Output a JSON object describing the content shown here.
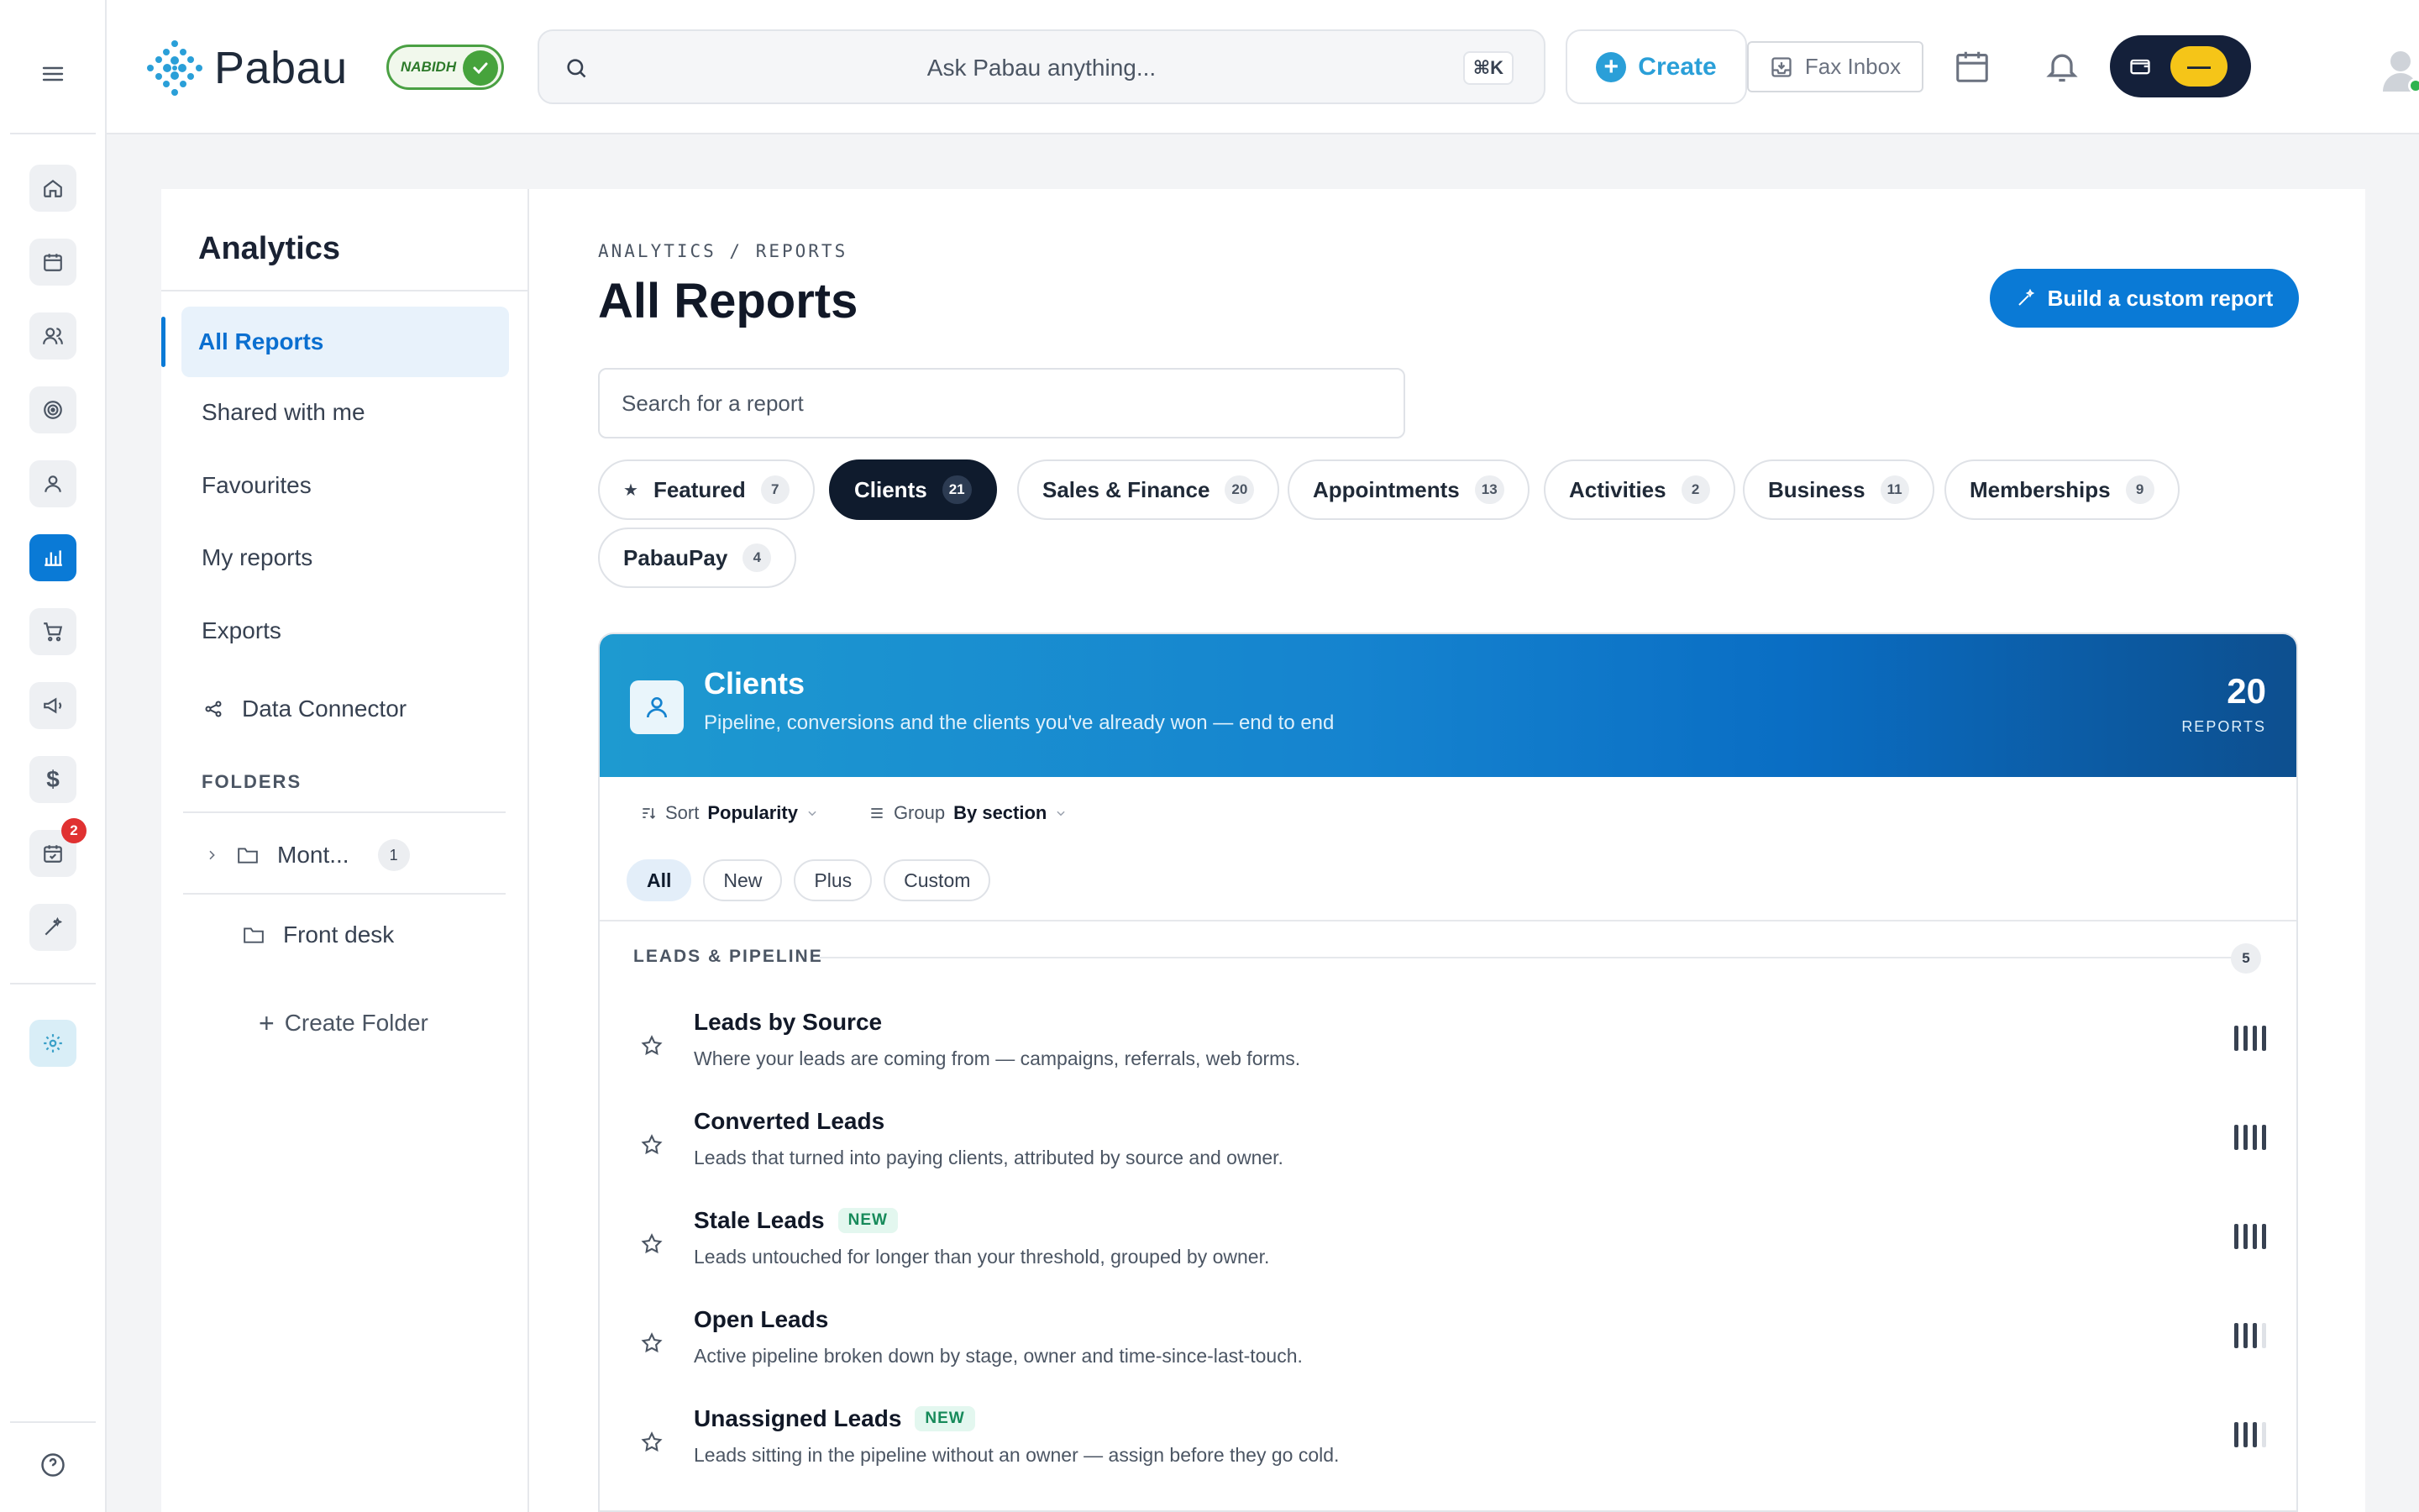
{
  "app": {
    "brand": "Pabau",
    "badge_text": "NABIDH"
  },
  "colors": {
    "accent": "#0a7ad6",
    "brand": "#2a9fd8",
    "dark": "#0f1b2d",
    "new_badge": "#168a5a",
    "notification": "#e03131"
  },
  "rail": {
    "items": [
      {
        "name": "menu",
        "icon": "hamburger-icon"
      },
      {
        "name": "home",
        "icon": "home-icon"
      },
      {
        "name": "calendar",
        "icon": "calendar-icon"
      },
      {
        "name": "contacts",
        "icon": "users-icon"
      },
      {
        "name": "leads",
        "icon": "target-icon"
      },
      {
        "name": "clients",
        "icon": "user-icon"
      },
      {
        "name": "analytics",
        "icon": "bar-chart-icon",
        "active": true
      },
      {
        "name": "shop",
        "icon": "cart-icon"
      },
      {
        "name": "marketing",
        "icon": "megaphone-icon"
      },
      {
        "name": "finance",
        "icon": "dollar-icon"
      },
      {
        "name": "tasks",
        "icon": "calendar-check-icon",
        "badge": "2"
      },
      {
        "name": "tools",
        "icon": "magic-wand-icon"
      },
      {
        "name": "settings",
        "icon": "gear-icon"
      },
      {
        "name": "help",
        "icon": "help-icon"
      }
    ]
  },
  "topbar": {
    "search_placeholder": "Ask Pabau anything...",
    "shortcut": "⌘K",
    "create_label": "Create",
    "fax_label": "Fax Inbox",
    "wallet_pill": "—"
  },
  "sidebar": {
    "title": "Analytics",
    "items": [
      {
        "label": "All Reports",
        "active": true
      },
      {
        "label": "Shared with me"
      },
      {
        "label": "Favourites"
      },
      {
        "label": "My reports"
      },
      {
        "label": "Exports"
      }
    ],
    "data_connector": "Data Connector",
    "folders_heading": "FOLDERS",
    "folders": [
      {
        "label": "Mont...",
        "count": "1",
        "expandable": true
      },
      {
        "label": "Front desk"
      }
    ],
    "create_folder": "Create Folder"
  },
  "main": {
    "breadcrumb": "ANALYTICS / REPORTS",
    "title": "All Reports",
    "build_button": "Build a custom report",
    "search_placeholder": "Search for a report",
    "categories": [
      {
        "label": "Featured",
        "count": "7",
        "star": true
      },
      {
        "label": "Clients",
        "count": "21",
        "active": true
      },
      {
        "label": "Sales & Finance",
        "count": "20"
      },
      {
        "label": "Appointments",
        "count": "13"
      },
      {
        "label": "Activities",
        "count": "2"
      },
      {
        "label": "Business",
        "count": "11"
      },
      {
        "label": "Memberships",
        "count": "9"
      },
      {
        "label": "PabauPay",
        "count": "4"
      }
    ]
  },
  "card": {
    "title": "Clients",
    "subtitle": "Pipeline, conversions and the clients you've already won — end to end",
    "count": "20",
    "count_label": "REPORTS",
    "sort_label": "Sort",
    "sort_value": "Popularity",
    "group_label": "Group",
    "group_value": "By section",
    "filters": [
      {
        "label": "All",
        "active": true
      },
      {
        "label": "New"
      },
      {
        "label": "Plus"
      },
      {
        "label": "Custom"
      }
    ],
    "section": {
      "title": "LEADS & PIPELINE",
      "count": "5"
    },
    "reports": [
      {
        "title": "Leads by Source",
        "desc": "Where your leads are coming from — campaigns, referrals, web forms.",
        "new": false,
        "popularity": 4
      },
      {
        "title": "Converted Leads",
        "desc": "Leads that turned into paying clients, attributed by source and owner.",
        "new": false,
        "popularity": 4
      },
      {
        "title": "Stale Leads",
        "desc": "Leads untouched for longer than your threshold, grouped by owner.",
        "new": true,
        "badge": "NEW",
        "popularity": 4
      },
      {
        "title": "Open Leads",
        "desc": "Active pipeline broken down by stage, owner and time-since-last-touch.",
        "new": false,
        "popularity": 3
      },
      {
        "title": "Unassigned Leads",
        "desc": "Leads sitting in the pipeline without an owner — assign before they go cold.",
        "new": true,
        "badge": "NEW",
        "popularity": 3
      }
    ]
  }
}
